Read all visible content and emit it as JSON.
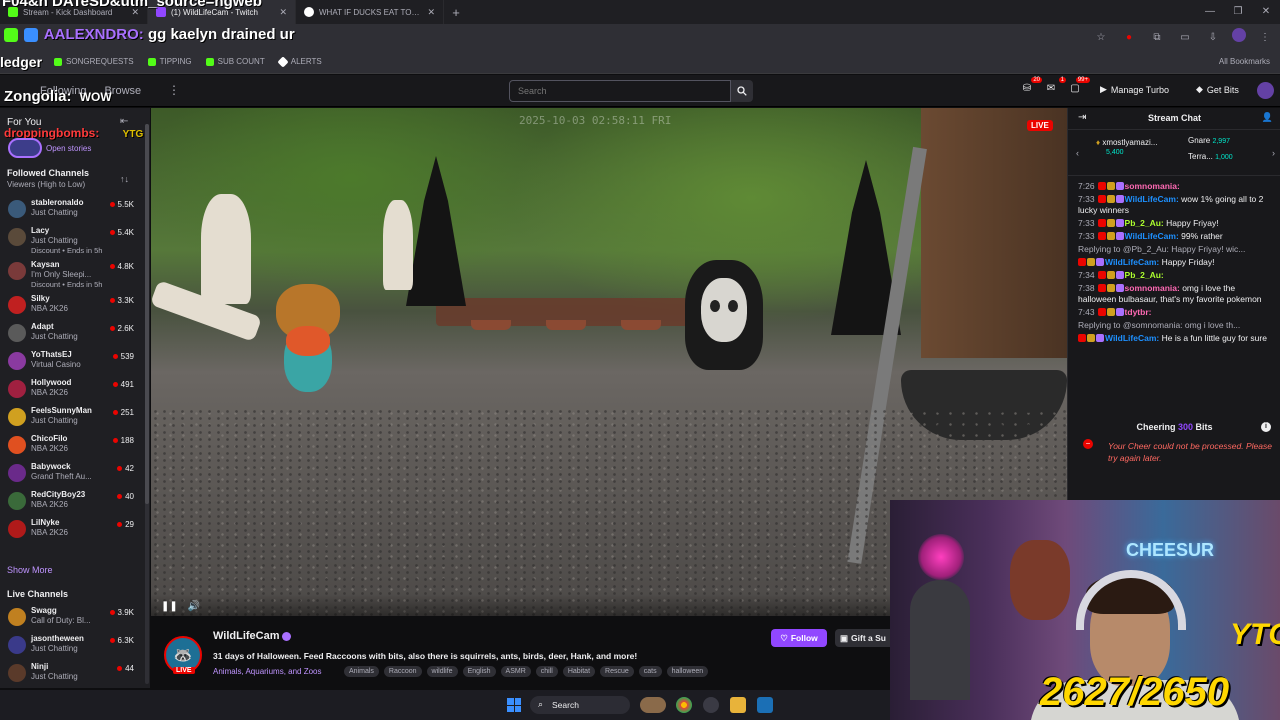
{
  "browser": {
    "tabs": [
      {
        "label": "Stream - Kick Dashboard",
        "color": "#53fc18",
        "active": false
      },
      {
        "label": "(1) WildLifeCam - Twitch",
        "color": "#9147ff",
        "active": true
      },
      {
        "label": "WHAT IF DUCKS EAT TOO MUC",
        "color": "#ffffff",
        "active": false
      }
    ],
    "overlay_title": "F04&n DATeSD&utm_source=ngweb",
    "new_tab": "+",
    "window_controls": [
      "—",
      "❐",
      "✕"
    ]
  },
  "overlay_chat": {
    "user": "AALEXNDRO:",
    "message": "gg kaelyn drained ur"
  },
  "bookmarks": {
    "ledger": "ledger",
    "items": [
      {
        "label": "SONGREQUESTS",
        "color": "#53fc18"
      },
      {
        "label": "TIPPING",
        "color": "#53fc18"
      },
      {
        "label": "SUB COUNT",
        "color": "#53fc18"
      },
      {
        "label": "ALERTS",
        "color": "#ffffff"
      }
    ],
    "all": "All Bookmarks"
  },
  "topnav": {
    "brand_overlay": "Zongolia:",
    "brand_overlay_extra": "WOW",
    "links": [
      "Following",
      "Browse"
    ],
    "more": "⋮",
    "search_placeholder": "Search",
    "notif_count_1": "20",
    "notif_count_2": "1",
    "notif_count_3": "99+",
    "manage_turbo": "Manage Turbo",
    "get_bits": "Get Bits"
  },
  "sidebar": {
    "for_you": "For You",
    "dropping_overlay": "droppingbombs:",
    "ytg_overlay": "YTG",
    "open_stories": "Open stories",
    "followed_title": "Followed Channels",
    "followed_sub": "Viewers (High to Low)",
    "followed": [
      {
        "name": "stableronaldo",
        "cat": "Just Chatting",
        "extra": "",
        "viewers": "5.5K",
        "color": "#3a5a7a"
      },
      {
        "name": "Lacy",
        "cat": "Just Chatting",
        "extra": "Discount • Ends in 5h",
        "viewers": "5.4K",
        "color": "#5a4a3a"
      },
      {
        "name": "Kaysan",
        "cat": "I'm Only Sleepi...",
        "extra": "Discount • Ends in 5h",
        "viewers": "4.8K",
        "color": "#7a3a3a"
      },
      {
        "name": "Silky",
        "cat": "NBA 2K26",
        "extra": "",
        "viewers": "3.3K",
        "color": "#c02020"
      },
      {
        "name": "Adapt",
        "cat": "Just Chatting",
        "extra": "",
        "viewers": "2.6K",
        "color": "#5a5a5a"
      },
      {
        "name": "YoThatsEJ",
        "cat": "Virtual Casino",
        "extra": "",
        "viewers": "539",
        "color": "#8a3aa0"
      },
      {
        "name": "Hollywood",
        "cat": "NBA 2K26",
        "extra": "",
        "viewers": "491",
        "color": "#a02040"
      },
      {
        "name": "FeelsSunnyMan",
        "cat": "Just Chatting",
        "extra": "",
        "viewers": "251",
        "color": "#d0a020"
      },
      {
        "name": "ChicoFilo",
        "cat": "NBA 2K26",
        "extra": "",
        "viewers": "188",
        "color": "#e05020"
      },
      {
        "name": "Babywock",
        "cat": "Grand Theft Au...",
        "extra": "",
        "viewers": "42",
        "color": "#6a2a8a"
      },
      {
        "name": "RedCityBoy23",
        "cat": "NBA 2K26",
        "extra": "",
        "viewers": "40",
        "color": "#3a6a3a"
      },
      {
        "name": "LilNyke",
        "cat": "NBA 2K26",
        "extra": "",
        "viewers": "29",
        "color": "#b01a1a"
      }
    ],
    "show_more": "Show More",
    "live_title": "Live Channels",
    "live": [
      {
        "name": "Swagg",
        "cat": "Call of Duty: Bl...",
        "viewers": "3.9K",
        "color": "#c08020"
      },
      {
        "name": "jasontheween",
        "cat": "Just Chatting",
        "viewers": "6.3K",
        "color": "#3a3a8a"
      },
      {
        "name": "Ninji",
        "cat": "Just Chatting",
        "viewers": "44",
        "color": "#5a3a2a"
      }
    ]
  },
  "video": {
    "timestamp": "2025-10-03 02:58:11 FRI",
    "live": "LIVE",
    "pause_icon": "❚❚",
    "volume_icon": "🔊"
  },
  "channel": {
    "name": "WildLifeCam",
    "live": "LIVE",
    "title": "31 days of Halloween. Feed Raccoons with bits, also there is squirrels, ants, birds, deer, Hank, and more!",
    "category": "Animals, Aquariums, and Zoos",
    "tags": [
      "Animals",
      "Raccoon",
      "wildlife",
      "English",
      "ASMR",
      "chill",
      "Habitat",
      "Rescue",
      "cats",
      "halloween"
    ],
    "follow": "Follow",
    "gift": "Gift a Su"
  },
  "chat": {
    "title": "Stream Chat",
    "pinned": [
      {
        "name": "xmostlyamazi...",
        "sub": "5,400"
      },
      {
        "name": "Gnare",
        "sub": "2,997"
      },
      {
        "name": "Terra...",
        "sub": "1,000"
      }
    ],
    "messages": [
      {
        "time": "7:26",
        "user": "somnomania:",
        "ucls": "u1",
        "text": "",
        "reply": ""
      },
      {
        "time": "7:33",
        "user": "WildLifeCam:",
        "ucls": "u2",
        "text": "wow 1% going all to 2 lucky winners",
        "reply": ""
      },
      {
        "time": "7:33",
        "user": "Pb_2_Au:",
        "ucls": "u3",
        "text": "Happy Friyay!",
        "reply": ""
      },
      {
        "time": "7:33",
        "user": "WildLifeCam:",
        "ucls": "u2",
        "text": "99% rather",
        "reply": ""
      },
      {
        "time": "",
        "user": "WildLifeCam:",
        "ucls": "u2",
        "text": "Happy Friday!",
        "reply": "Replying to @Pb_2_Au: Happy Friyay! wic..."
      },
      {
        "time": "7:34",
        "user": "Pb_2_Au:",
        "ucls": "u3",
        "text": "",
        "reply": ""
      },
      {
        "time": "7:38",
        "user": "somnomania:",
        "ucls": "u1",
        "text": "omg i love the halloween bulbasaur, that's my favorite pokemon",
        "reply": ""
      },
      {
        "time": "7:43",
        "user": "tdytbr:",
        "ucls": "u1",
        "text": "",
        "reply": ""
      },
      {
        "time": "",
        "user": "WildLifeCam:",
        "ucls": "u2",
        "text": "He is a fun little guy for sure",
        "reply": "Replying to @somnomania: omg i love th..."
      }
    ],
    "cheer_prefix": "Cheering",
    "cheer_amount": "300",
    "cheer_suffix": "Bits",
    "error": "Your Cheer could not be processed. Please try again later."
  },
  "webcam": {
    "sign": "CHEESUR",
    "ytg": "YTG",
    "counter": "2627/2650"
  },
  "taskbar": {
    "search": "Search"
  }
}
